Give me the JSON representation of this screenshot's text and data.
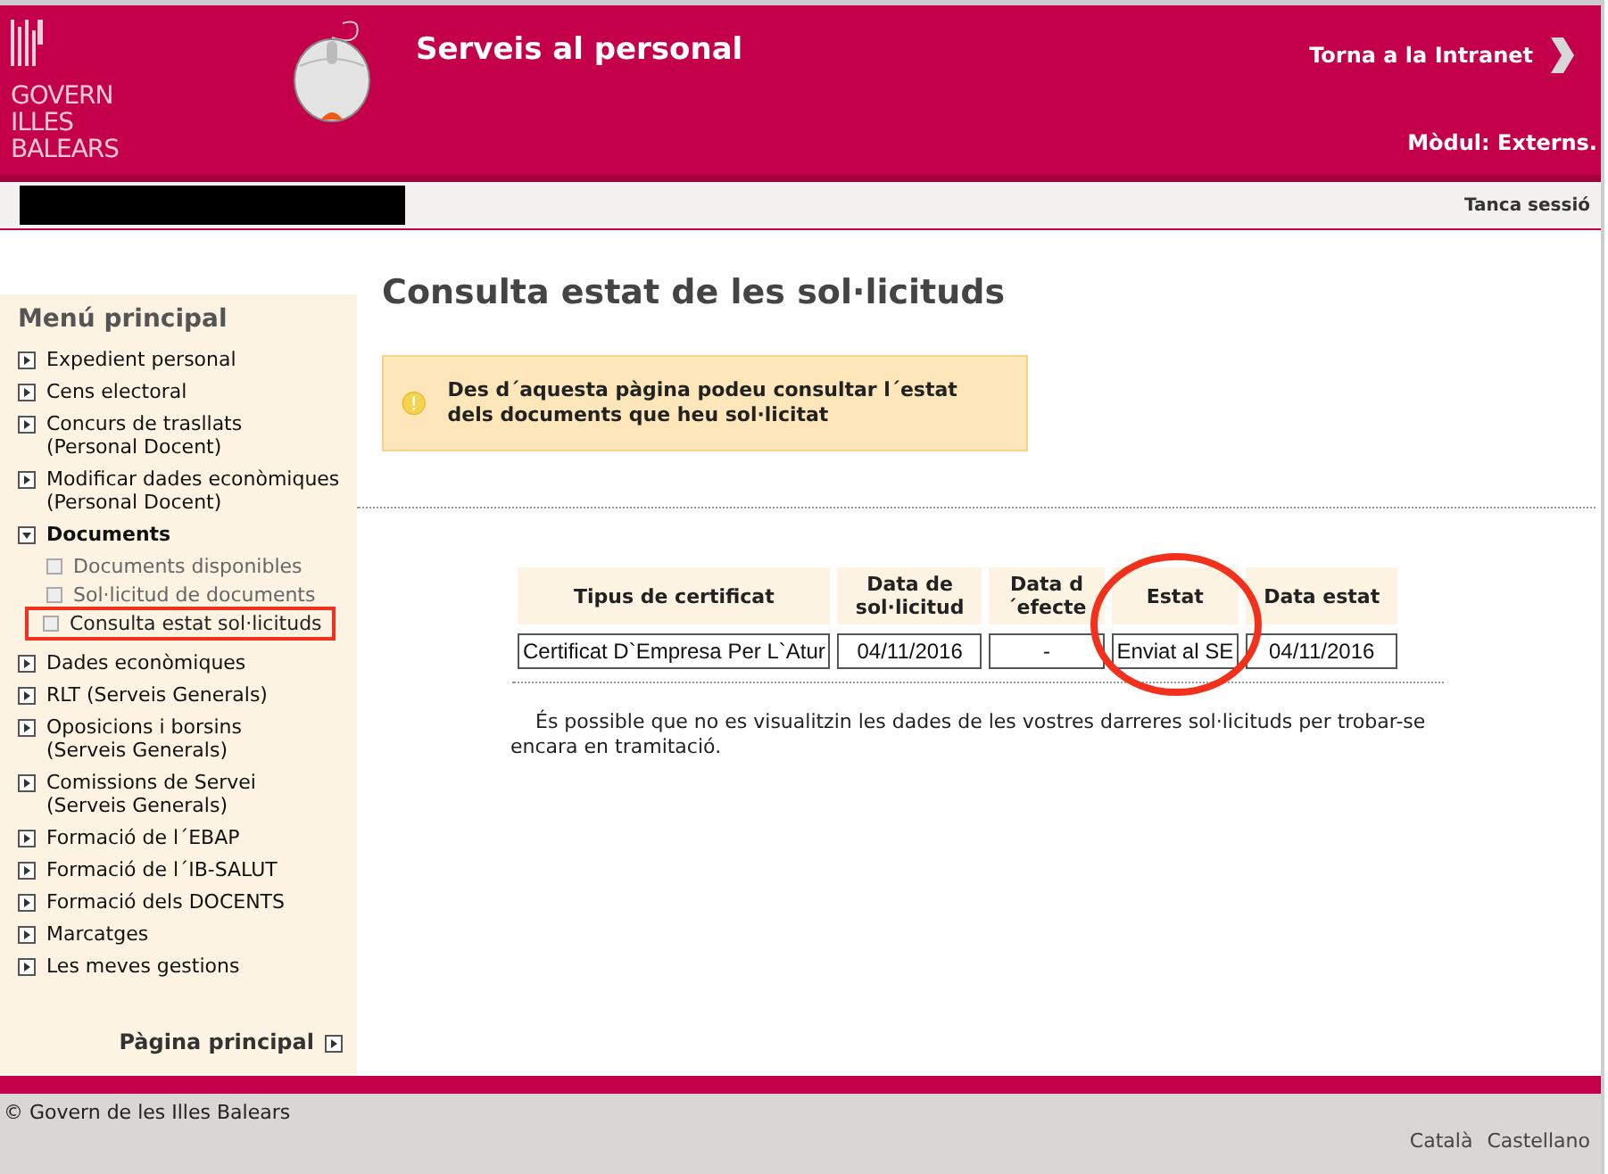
{
  "header": {
    "logo_lines": [
      "GOVERN",
      "ILLES",
      "BALEARS"
    ],
    "title": "Serveis al personal",
    "back_link": "Torna a la Intranet",
    "module": "Mòdul: Externs."
  },
  "user_bar": {
    "redacted": true,
    "logout": "Tanca sessió"
  },
  "sidebar": {
    "title": "Menú principal",
    "items": [
      {
        "label": "Expedient personal",
        "expanded": false
      },
      {
        "label": "Cens electoral",
        "expanded": false
      },
      {
        "label": "Concurs de trasllats\n(Personal Docent)",
        "expanded": false
      },
      {
        "label": "Modificar dades econòmiques\n(Personal Docent)",
        "expanded": false
      },
      {
        "label": "Documents",
        "expanded": true,
        "children": [
          {
            "label": "Documents disponibles",
            "selected": false
          },
          {
            "label": "Sol·licitud de documents",
            "selected": false
          },
          {
            "label": "Consulta estat sol·licituds",
            "selected": true
          }
        ]
      },
      {
        "label": "Dades econòmiques",
        "expanded": false
      },
      {
        "label": "RLT (Serveis Generals)",
        "expanded": false
      },
      {
        "label": "Oposicions i borsins\n(Serveis Generals)",
        "expanded": false
      },
      {
        "label": "Comissions de Servei\n(Serveis Generals)",
        "expanded": false
      },
      {
        "label": "Formació de l´EBAP",
        "expanded": false
      },
      {
        "label": "Formació de l´IB-SALUT",
        "expanded": false
      },
      {
        "label": "Formació dels DOCENTS",
        "expanded": false
      },
      {
        "label": "Marcatges",
        "expanded": false
      },
      {
        "label": "Les meves gestions",
        "expanded": false
      }
    ],
    "home_link": "Pàgina principal"
  },
  "page_title": "Consulta estat de les sol·licituds",
  "notice": "Des d´aquesta pàgina podeu consultar l´estat dels documents que heu sol·licitat",
  "table": {
    "columns": [
      {
        "label": "Tipus de certificat",
        "highlighted": false
      },
      {
        "label": "Data de\nsol·licitud",
        "highlighted": false
      },
      {
        "label": "Data d\n´efecte",
        "highlighted": false
      },
      {
        "label": "Estat",
        "highlighted": true
      },
      {
        "label": "Data estat",
        "highlighted": false
      }
    ],
    "rows": [
      [
        "Certificat D`Empresa Per L`Atur",
        "04/11/2016",
        "-",
        "Enviat al SE",
        "04/11/2016"
      ]
    ]
  },
  "note": "És possible que no es visualitzin les dades de les vostres darreres sol·licituds per trobar-se encara en tramitació.",
  "footer": {
    "copyright": "© Govern de les Illes Balears",
    "languages": [
      "Català",
      "Castellano"
    ]
  }
}
